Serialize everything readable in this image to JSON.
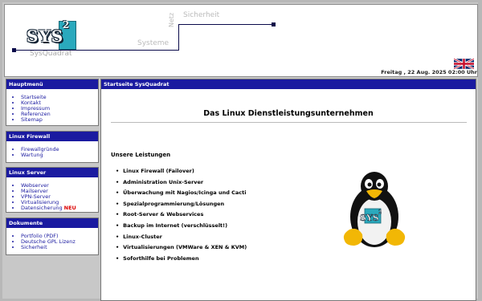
{
  "header": {
    "logo_text": "SYS",
    "logo_sup": "2",
    "brand": "SysQuadrat",
    "words": {
      "sicherheit": "Sicherheit",
      "systeme": "Systeme",
      "netz": "Netz"
    },
    "date": "Freitag , 22 Aug. 2025 02:00 Uhr",
    "flag_icon": "uk-flag-icon"
  },
  "sidebar": [
    {
      "title": "Hauptmenü",
      "items": [
        "Startseite",
        "Kontakt",
        "Impressum",
        "Referenzen",
        "Sitemap"
      ]
    },
    {
      "title": "Linux Firewall",
      "items": [
        "Firewallgründe",
        "Wartung"
      ]
    },
    {
      "title": "Linux Server",
      "items": [
        "Webserver",
        "Mailserver",
        "VPN-Server",
        "Virtualisierung",
        "Datensicherung"
      ],
      "new_badge": "NEU"
    },
    {
      "title": "Dokumente",
      "items": [
        "Portfolio (PDF)",
        "Deutsche GPL Lizenz",
        "Sicherheit"
      ]
    }
  ],
  "main": {
    "title": "Startseite SysQuadrat",
    "heading": "Das Linux Dienstleistungsunternehmen",
    "subheading": "Unsere Leistungen",
    "services": [
      "Linux Firewall (Failover)",
      "Administration Unix-Server",
      "Überwachung mit Nagios/Icinga und Cacti",
      "Spezialprogrammierung/Lösungen",
      "Root-Server & Webservices",
      "Backup im Internet (verschlüsselt!)",
      "Linux-Cluster",
      "Virtualisierungen (VMWare & XEN & KVM)",
      "Soforthilfe bei Problemen"
    ],
    "mascot": "tux-penguin",
    "mascot_logo": "SYS",
    "mascot_logo_sup": "2"
  }
}
